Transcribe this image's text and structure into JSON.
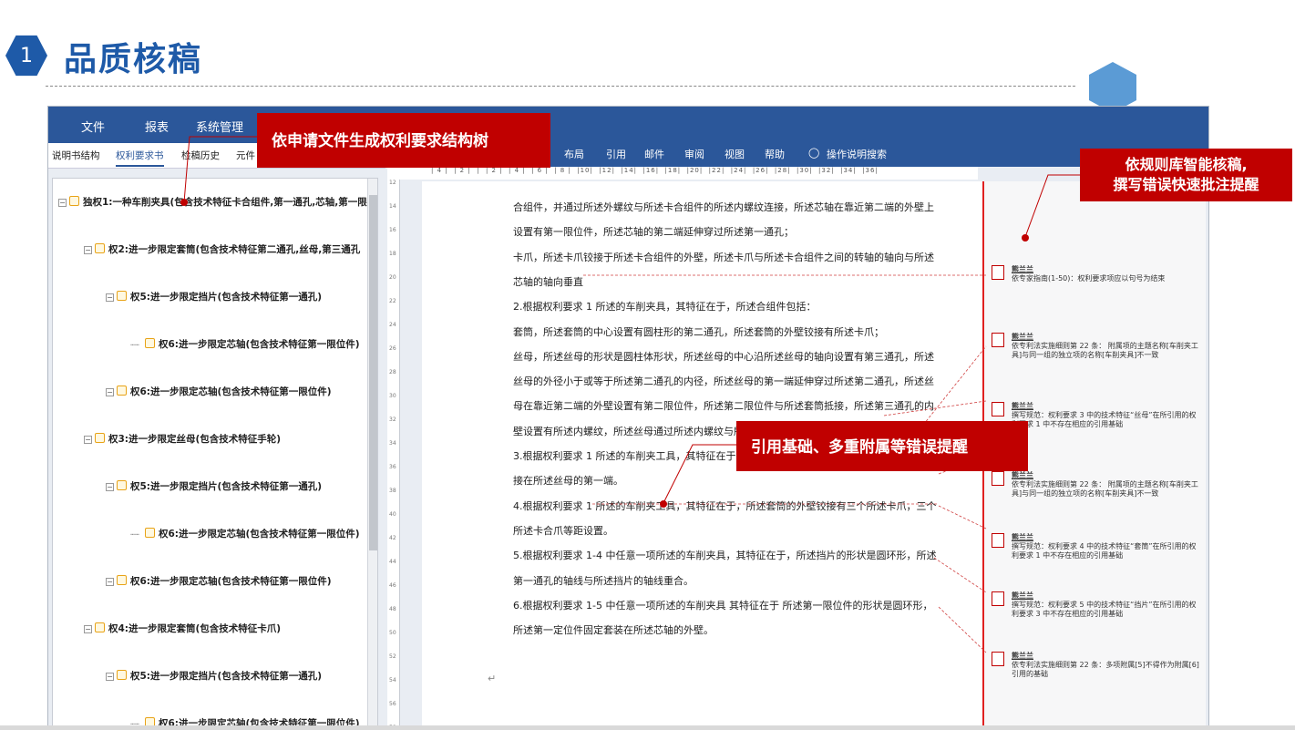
{
  "header": {
    "badge": "1",
    "title": "品质核稿"
  },
  "ribbon": {
    "tabs": [
      "文件",
      "报表",
      "系统管理"
    ],
    "tabs2": [
      "布局",
      "引用",
      "邮件",
      "审阅",
      "视图",
      "帮助",
      "操作说明搜索"
    ]
  },
  "subtabs": [
    "说明书结构",
    "权利要求书",
    "检稿历史",
    "元件"
  ],
  "tree": [
    {
      "label": "独权1:一种车削夹具(包含技术特征卡合组件,第一通孔,芯轴,第一限",
      "level": 0
    },
    {
      "label": "权2:进一步限定套筒(包含技术特征第二通孔,丝母,第三通孔",
      "level": 1
    },
    {
      "label": "权5:进一步限定挡片(包含技术特征第一通孔)",
      "level": 2
    },
    {
      "label": "权6:进一步限定芯轴(包含技术特征第一限位件)",
      "level": 3
    },
    {
      "label": "权6:进一步限定芯轴(包含技术特征第一限位件)",
      "level": 2
    },
    {
      "label": "权3:进一步限定丝母(包含技术特征手轮)",
      "level": 1
    },
    {
      "label": "权5:进一步限定挡片(包含技术特征第一通孔)",
      "level": 2
    },
    {
      "label": "权6:进一步限定芯轴(包含技术特征第一限位件)",
      "level": 3
    },
    {
      "label": "权6:进一步限定芯轴(包含技术特征第一限位件)",
      "level": 2
    },
    {
      "label": "权4:进一步限定套筒(包含技术特征卡爪)",
      "level": 1
    },
    {
      "label": "权5:进一步限定挡片(包含技术特征第一通孔)",
      "level": 2
    },
    {
      "label": "权6:进一步限定芯轴(包含技术特征第一限位件)",
      "level": 3
    }
  ],
  "doc_lines": [
    "合组件，并通过所述外螺纹与所述卡合组件的所述内螺纹连接，所述芯轴在靠近第二端的外壁上",
    "设置有第一限位件，所述芯轴的第二端延伸穿过所述第一通孔；",
    "卡爪，所述卡爪铰接于所述卡合组件的外壁，所述卡爪与所述卡合组件之间的转轴的轴向与所述",
    "芯轴的轴向垂直",
    "2.根据权利要求 1 所述的车削夹具，其特征在于，所述合组件包括：",
    "套筒，所述套筒的中心设置有圆柱形的第二通孔，所述套筒的外壁铰接有所述卡爪；",
    "丝母，所述丝母的形状是圆柱体形状，所述丝母的中心沿所述丝母的轴向设置有第三通孔，所述",
    "丝母的外径小于或等于所述第二通孔的内径，所述丝母的第一端延伸穿过所述第二通孔，所述丝",
    "母在靠近第二端的外壁设置有第二限位件，所述第二限位件与所述套筒抵接，所述第三通孔的内",
    "壁设置有所述内螺纹，所述丝母通过所述内螺纹与所",
    "3.根据权利要求 1 所述的车削夹工具，其特征在于，",
    "接在所述丝母的第一端。",
    "4.根据权利要求 1 所述的车削夹工具，其特征在于，所述套筒的外壁铰接有三个所述卡爪，三个",
    "所述卡合爪等距设置。",
    "5.根据权利要求 1-4 中任意一项所述的车削夹具，其特征在于，所述挡片的形状是圆环形，所述",
    "第一通孔的轴线与所述挡片的轴线重合。",
    "6.根据权利要求 1-5 中任意一项所述的车削夹具 其特征在于 所述第一限位件的形状是圆环形，",
    "所述第一定位件固定套装在所述芯轴的外壁。"
  ],
  "comments": [
    {
      "name": "熊兰兰",
      "text": "依专家指南(1-50)：权利要求项应以句号为结束"
    },
    {
      "name": "熊兰兰",
      "text": "依专利法实施细则第 22 条： 附属项的主题名称[车削夹工具]与同一组的独立项的名称[车削夹具]不一致"
    },
    {
      "name": "熊兰兰",
      "text": "撰写规范：权利要求 3 中的技术特征“丝母”在所引用的权利要求 1 中不存在相应的引用基础"
    },
    {
      "name": "熊兰兰",
      "text": "依专利法实施细则第 22 条： 附属项的主题名称[车削夹工具]与同一组的独立项的名称[车削夹具]不一致"
    },
    {
      "name": "熊兰兰",
      "text": "撰写规范：权利要求 4 中的技术特征“套筒”在所引用的权利要求 1 中不存在相应的引用基础"
    },
    {
      "name": "熊兰兰",
      "text": "撰写规范：权利要求 5 中的技术特征“挡片”在所引用的权利要求 3 中不存在相应的引用基础"
    },
    {
      "name": "熊兰兰",
      "text": "依专利法实施细则第 22 条：多项附属[5]不得作为附属[6]引用的基础"
    }
  ],
  "callouts": {
    "tree": "依申请文件生成权利要求结构树",
    "rules": "依规则库智能核稿,\n撰写错误快速批注提醒",
    "ref": "引用基础、多重附属等错误提醒"
  },
  "colors": {
    "brand": "#1e5aa8",
    "ribbon": "#2b579a",
    "callout": "#c00000"
  }
}
